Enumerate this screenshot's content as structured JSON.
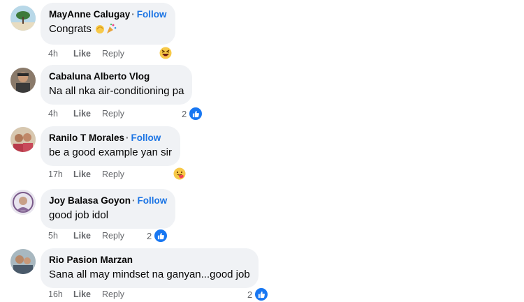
{
  "comments": [
    {
      "author": "MayAnne Calugay",
      "follow": "Follow",
      "text": "Congrats",
      "time": "4h",
      "like": "Like",
      "reply": "Reply",
      "reaction": "haha-icon",
      "reaction_count": ""
    },
    {
      "author": "Cabaluna Alberto Vlog",
      "follow": "",
      "text": "Na all nka air-conditioning pa",
      "time": "4h",
      "like": "Like",
      "reply": "Reply",
      "reaction": "like-icon",
      "reaction_count": "2"
    },
    {
      "author": "Ranilo T Morales",
      "follow": "Follow",
      "text": "be a good example yan sir",
      "time": "17h",
      "like": "Like",
      "reply": "Reply",
      "reaction": "care-icon",
      "reaction_count": ""
    },
    {
      "author": "Joy Balasa Goyon",
      "follow": "Follow",
      "text": "good job idol",
      "time": "5h",
      "like": "Like",
      "reply": "Reply",
      "reaction": "like-icon",
      "reaction_count": "2"
    },
    {
      "author": "Rio Pasion Marzan",
      "follow": "",
      "text": "Sana all may mindset na ganyan...good job",
      "time": "16h",
      "like": "Like",
      "reply": "Reply",
      "reaction": "like-icon",
      "reaction_count": "2"
    }
  ],
  "colors": {
    "follow": "#1b74e4",
    "bubble": "#f0f2f5",
    "meta": "#65676b",
    "like_reaction": "#1877f2"
  }
}
